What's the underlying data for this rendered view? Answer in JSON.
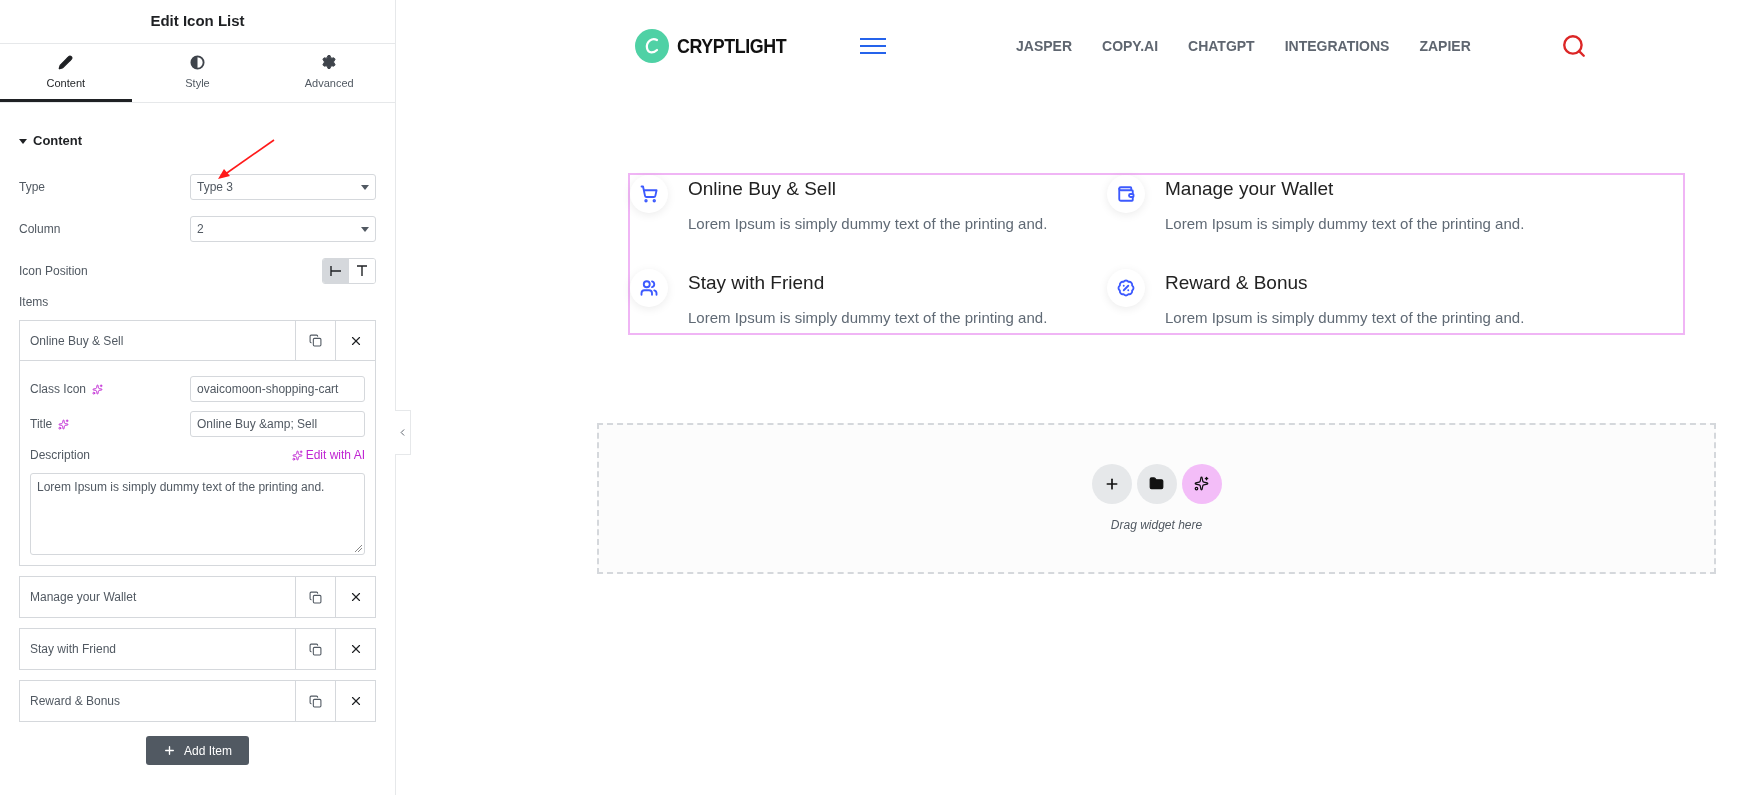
{
  "panel": {
    "title": "Edit Icon List",
    "tabs": [
      {
        "label": "Content",
        "selected": true
      },
      {
        "label": "Style",
        "selected": false
      },
      {
        "label": "Advanced",
        "selected": false
      }
    ],
    "section": {
      "title": "Content",
      "expanded": true
    },
    "type": {
      "label": "Type",
      "value": "Type 3"
    },
    "column": {
      "label": "Column",
      "value": "2"
    },
    "icon_position": {
      "label": "Icon Position",
      "options": [
        {
          "selected": true
        },
        {
          "selected": false
        }
      ]
    },
    "items_label": "Items",
    "items": [
      {
        "title": "Online Buy & Sell",
        "expanded": true,
        "class_icon_label": "Class Icon",
        "class_icon": "ovaicomoon-shopping-cart",
        "title_label": "Title",
        "title_value": "Online Buy &amp; Sell",
        "description_label": "Description",
        "edit_ai": "Edit with AI",
        "description": "Lorem Ipsum is simply dummy text of the printing and."
      },
      {
        "title": "Manage your Wallet",
        "expanded": false
      },
      {
        "title": "Stay with Friend",
        "expanded": false
      },
      {
        "title": "Reward & Bonus",
        "expanded": false
      }
    ],
    "add_item": "Add Item"
  },
  "site": {
    "logo": "CRYPTLIGHT",
    "nav": [
      "JASPER",
      "COPY.AI",
      "CHATGPT",
      "INTEGRATIONS",
      "ZAPIER"
    ]
  },
  "features": [
    {
      "title": "Online Buy & Sell",
      "description": "Lorem Ipsum is simply dummy text of the printing and."
    },
    {
      "title": "Manage your Wallet",
      "description": "Lorem Ipsum is simply dummy text of the printing and."
    },
    {
      "title": "Stay with Friend",
      "description": "Lorem Ipsum is simply dummy text of the printing and."
    },
    {
      "title": "Reward & Bonus",
      "description": "Lorem Ipsum is simply dummy text of the printing and."
    }
  ],
  "drop_zone": {
    "hint": "Drag widget here"
  }
}
